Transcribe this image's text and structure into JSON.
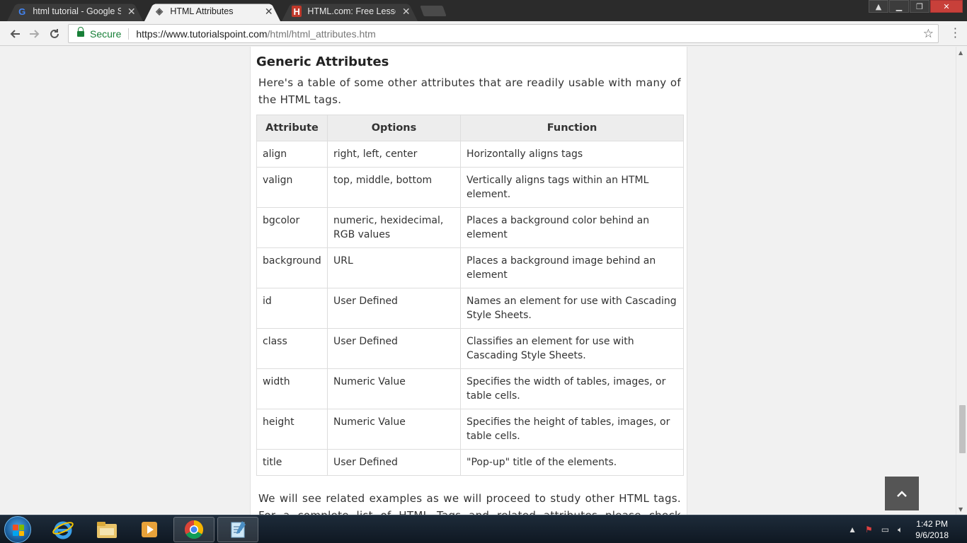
{
  "browser": {
    "tabs": [
      {
        "title": "html tutorial - Google Se",
        "favicon": "G",
        "active": false
      },
      {
        "title": "HTML Attributes",
        "favicon": "◈",
        "active": true
      },
      {
        "title": "HTML.com: Free Lessons",
        "favicon": "H",
        "active": false
      }
    ],
    "secure_label": "Secure",
    "url_host": "https://www.tutorialspoint.com",
    "url_path": "/html/html_attributes.htm"
  },
  "page": {
    "heading": "Generic Attributes",
    "intro": "Here's a table of some other attributes that are readily usable with many of the HTML tags.",
    "table": {
      "headers": [
        "Attribute",
        "Options",
        "Function"
      ],
      "rows": [
        {
          "attribute": "align",
          "options": "right, left, center",
          "function": "Horizontally aligns tags"
        },
        {
          "attribute": "valign",
          "options": "top, middle, bottom",
          "function": "Vertically aligns tags within an HTML element."
        },
        {
          "attribute": "bgcolor",
          "options": "numeric, hexidecimal, RGB values",
          "function": "Places a background color behind an element"
        },
        {
          "attribute": "background",
          "options": "URL",
          "function": "Places a background image behind an element"
        },
        {
          "attribute": "id",
          "options": "User Defined",
          "function": "Names an element for use with Cascading Style Sheets."
        },
        {
          "attribute": "class",
          "options": "User Defined",
          "function": "Classifies an element for use with Cascading Style Sheets."
        },
        {
          "attribute": "width",
          "options": "Numeric Value",
          "function": "Specifies the width of tables, images, or table cells."
        },
        {
          "attribute": "height",
          "options": "Numeric Value",
          "function": "Specifies the height of tables, images, or table cells."
        },
        {
          "attribute": "title",
          "options": "User Defined",
          "function": "\"Pop-up\" title of the elements."
        }
      ]
    },
    "outro": "We will see related examples as we will proceed to study other HTML tags. For a complete list of HTML Tags and related attributes please check reference to"
  },
  "taskbar": {
    "time": "1:42 PM",
    "date": "9/6/2018"
  },
  "colors": {
    "chrome_dark": "#2b2b2b",
    "secure_green": "#188038",
    "header_bg": "#ededed"
  }
}
